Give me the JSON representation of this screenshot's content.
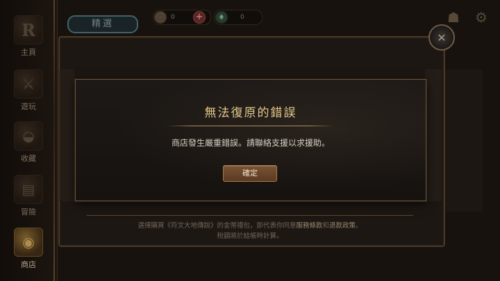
{
  "sidebar": {
    "items": [
      {
        "label": "主頁",
        "icon": "rune-logo-icon"
      },
      {
        "label": "遊玩",
        "icon": "crossed-swords-icon"
      },
      {
        "label": "收藏",
        "icon": "satchel-icon"
      },
      {
        "label": "冒險",
        "icon": "scroll-map-icon"
      },
      {
        "label": "商店",
        "icon": "gold-coins-icon"
      }
    ],
    "active_index": 4
  },
  "header": {
    "tab_label": "精選",
    "currency": {
      "coins_value": "0",
      "shards_value": "0"
    }
  },
  "store": {
    "terms_line1_before": "選擇購買《符文大地傳說》的金幣禮包，即代表你同意",
    "terms_link_service": "服務條款",
    "terms_and": "和",
    "terms_link_refund": "退款政策",
    "terms_period": "。",
    "terms_line2": "稅額將於結帳時計算。"
  },
  "dialog": {
    "title": "無法復原的錯誤",
    "message": "商店發生嚴重錯誤。請聯絡支援以求援助。",
    "confirm_label": "確定"
  },
  "colors": {
    "dialog_title": "#e4c98a",
    "accent_gold": "#b0905a",
    "button_bg": "#6a4529",
    "tab_border": "#4f7f8d",
    "plus_red": "#7a2d2d"
  }
}
